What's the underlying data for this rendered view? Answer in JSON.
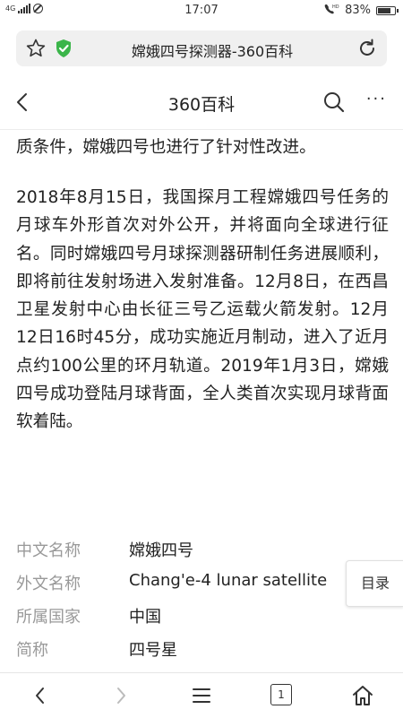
{
  "status_bar": {
    "network": "4G",
    "time": "17:07",
    "battery": "83%",
    "battery_level": 0.83
  },
  "url_bar": {
    "title": "嫦娥四号探测器-360百科"
  },
  "header": {
    "title": "360百科",
    "more": "···"
  },
  "content": {
    "paragraphs": [
      "质条件，嫦娥四号也进行了针对性改进。",
      "2018年8月15日，我国探月工程嫦娥四号任务的月球车外形首次对外公开，并将面向全球进行征名。同时嫦娥四号月球探测器研制任务进展顺利，即将前往发射场进入发射准备。12月8日，在西昌卫星发射中心由长征三号乙运载火箭发射。12月12日16时45分，成功实施近月制动，进入了近月点约100公里的环月轨道。2019年1月3日，嫦娥四号成功登陆月球背面，全人类首次实现月球背面软着陆。"
    ],
    "info": [
      {
        "label": "中文名称",
        "value": "嫦娥四号"
      },
      {
        "label": "外文名称",
        "value": "Chang'e-4 lunar satellite"
      },
      {
        "label": "所属国家",
        "value": "中国"
      },
      {
        "label": "简称",
        "value": "四号星"
      }
    ],
    "toc_label": "目录"
  },
  "bottom_nav": {
    "tabs_count": "1"
  },
  "colors": {
    "shield": "#3bb54a",
    "label_gray": "#999999",
    "text": "#222222"
  }
}
